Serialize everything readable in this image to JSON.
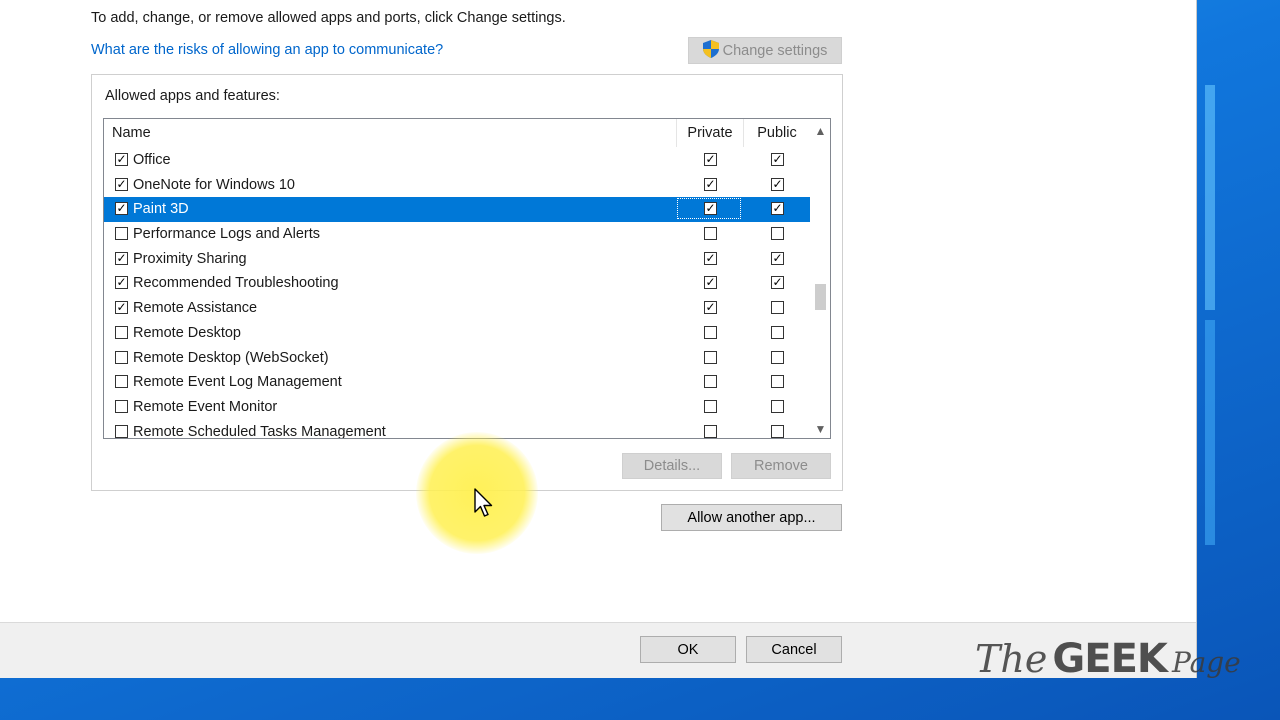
{
  "header": {
    "instruction": "To add, change, or remove allowed apps and ports, click Change settings.",
    "risk_link": "What are the risks of allowing an app to communicate?",
    "change_settings_label": "Change settings"
  },
  "group": {
    "title": "Allowed apps and features:",
    "columns": {
      "name": "Name",
      "private": "Private",
      "public": "Public"
    },
    "rows": [
      {
        "name": "Office",
        "enabled": true,
        "private": true,
        "public": true
      },
      {
        "name": "OneNote for Windows 10",
        "enabled": true,
        "private": true,
        "public": true
      },
      {
        "name": "Paint 3D",
        "enabled": true,
        "private": true,
        "public": true,
        "selected": true
      },
      {
        "name": "Performance Logs and Alerts",
        "enabled": false,
        "private": false,
        "public": false
      },
      {
        "name": "Proximity Sharing",
        "enabled": true,
        "private": true,
        "public": true
      },
      {
        "name": "Recommended Troubleshooting",
        "enabled": true,
        "private": true,
        "public": true
      },
      {
        "name": "Remote Assistance",
        "enabled": true,
        "private": true,
        "public": false
      },
      {
        "name": "Remote Desktop",
        "enabled": false,
        "private": false,
        "public": false
      },
      {
        "name": "Remote Desktop (WebSocket)",
        "enabled": false,
        "private": false,
        "public": false
      },
      {
        "name": "Remote Event Log Management",
        "enabled": false,
        "private": false,
        "public": false
      },
      {
        "name": "Remote Event Monitor",
        "enabled": false,
        "private": false,
        "public": false
      },
      {
        "name": "Remote Scheduled Tasks Management",
        "enabled": false,
        "private": false,
        "public": false
      }
    ],
    "details_label": "Details...",
    "remove_label": "Remove"
  },
  "allow_another_label": "Allow another app...",
  "footer": {
    "ok_label": "OK",
    "cancel_label": "Cancel"
  },
  "watermark": {
    "the": "The",
    "geek": "GEEK",
    "page": "Page"
  },
  "colors": {
    "selection": "#0078d7",
    "link": "#0066cc",
    "desktop": "#1177dd"
  },
  "icons": {
    "change_settings": "uac-shield-icon",
    "scroll_up": "chevron-up-icon",
    "scroll_down": "chevron-down-icon"
  }
}
